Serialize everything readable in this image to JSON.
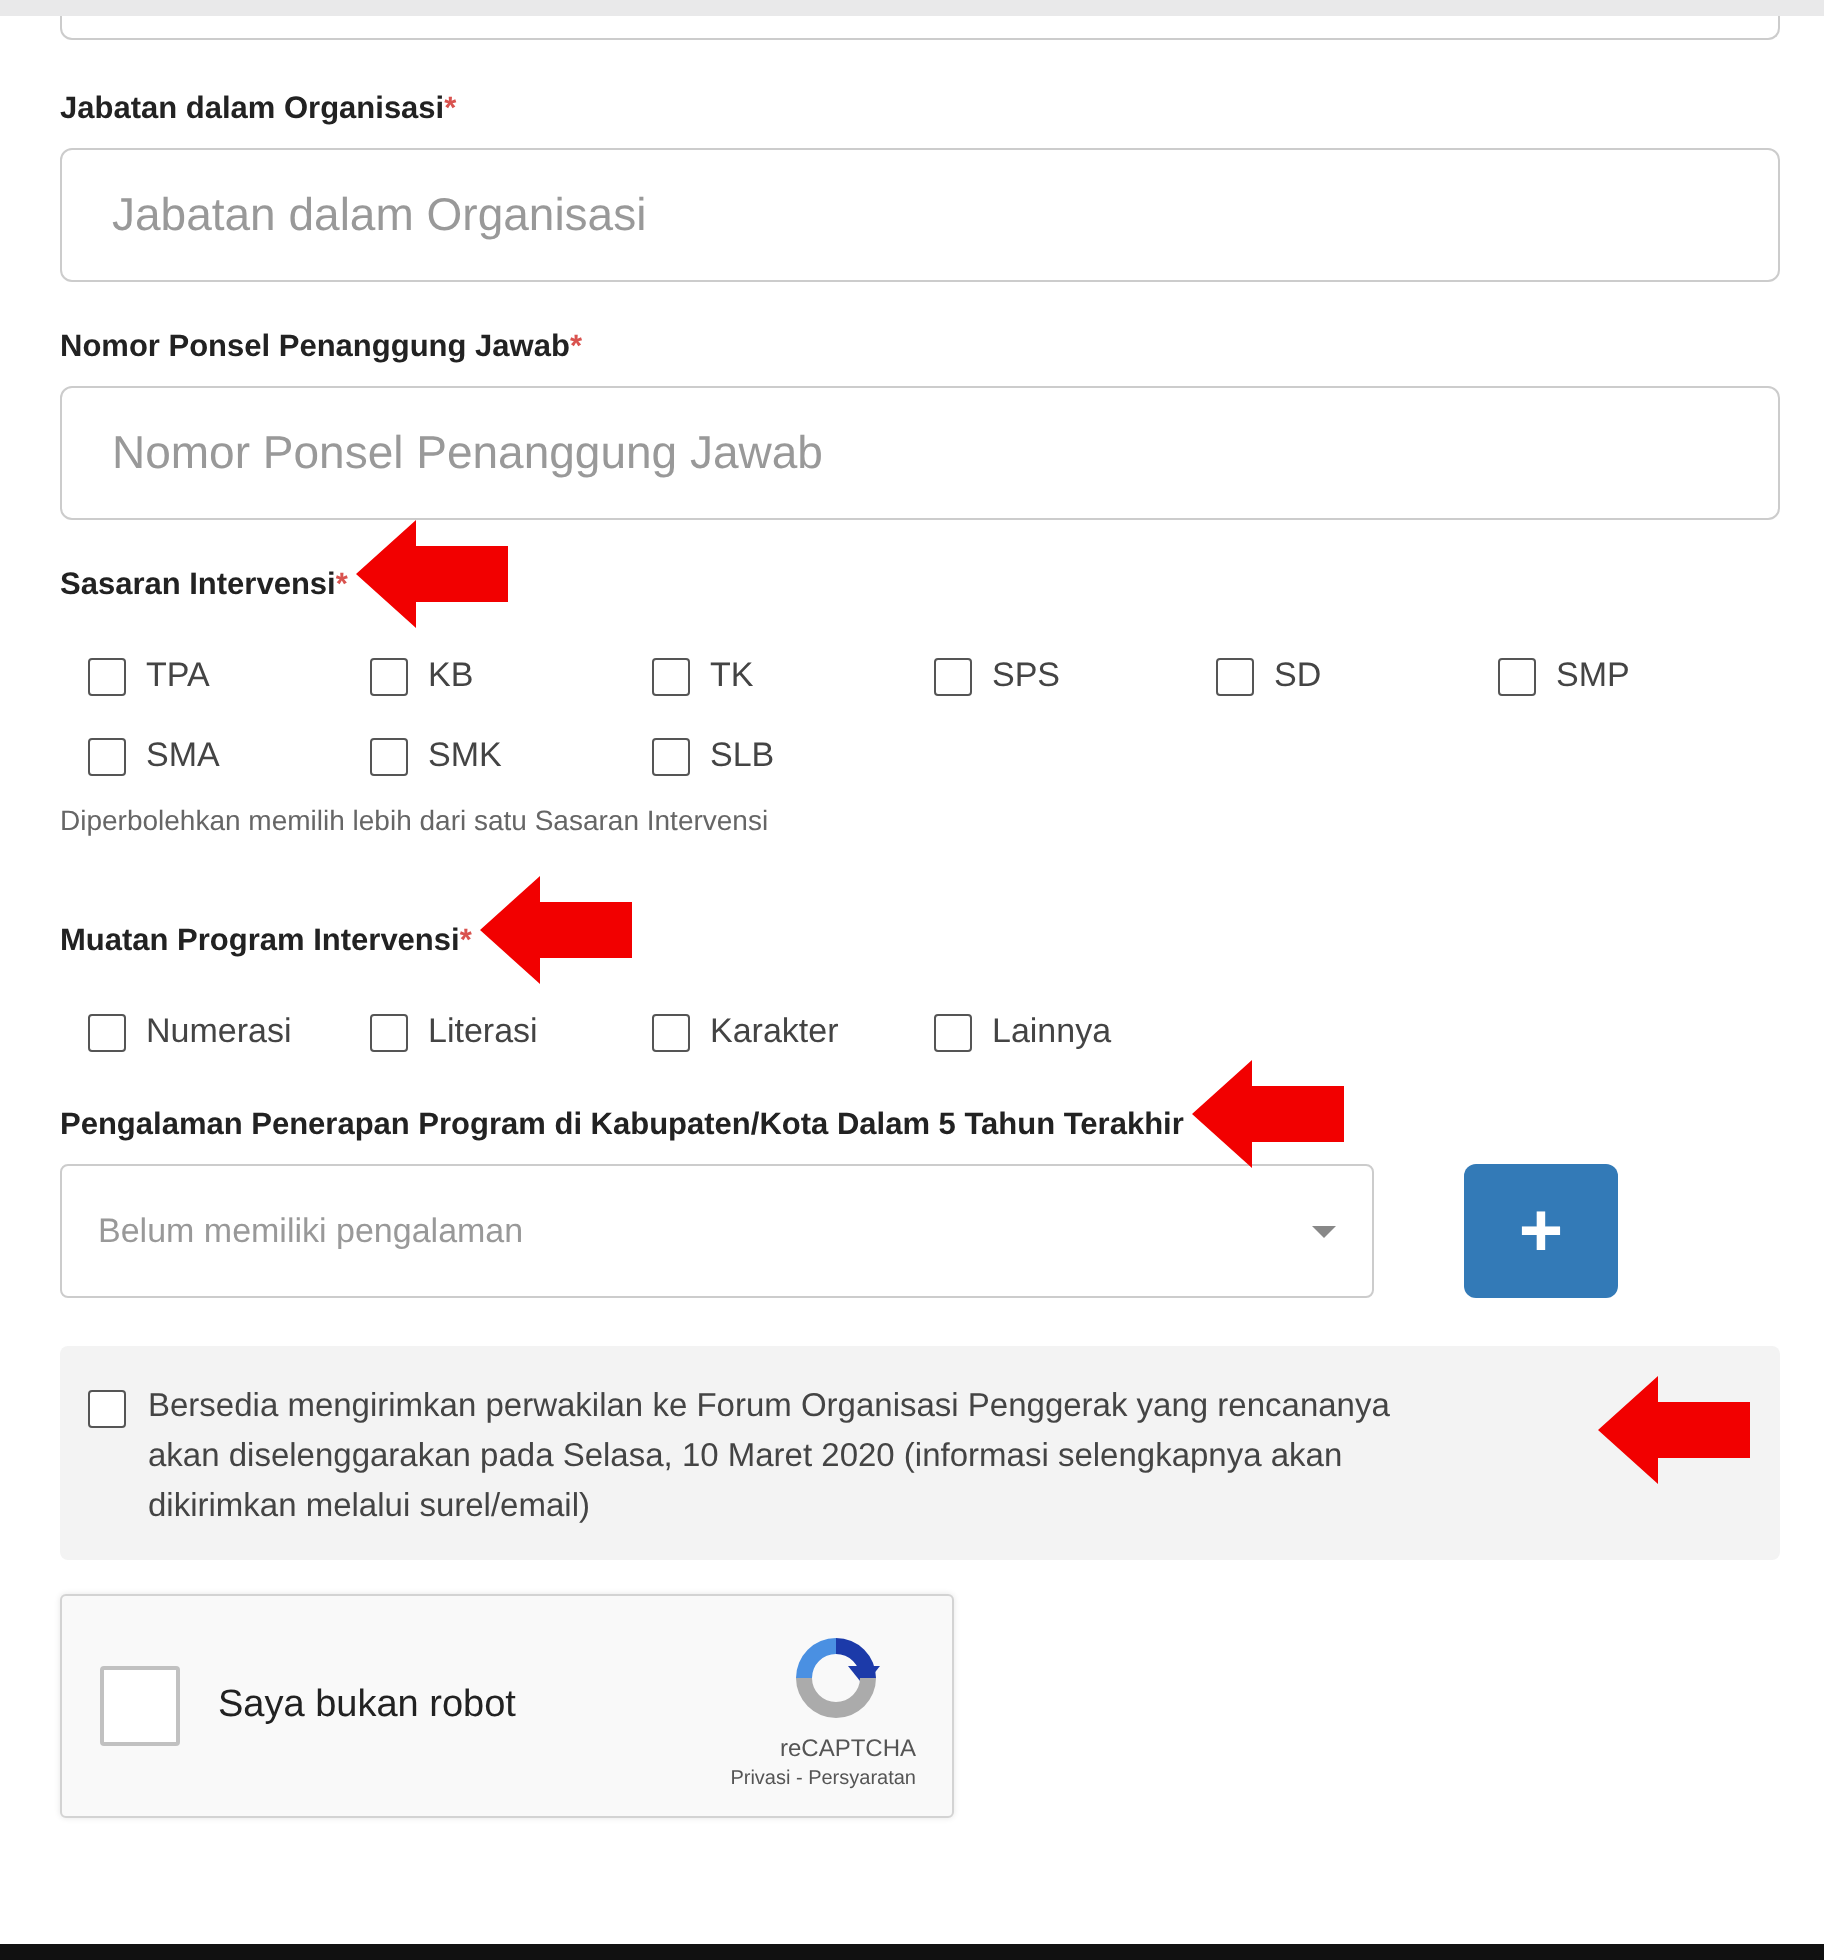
{
  "fields": [
    {
      "label": "Jabatan dalam Organisasi",
      "required_mark": "*",
      "placeholder": "Jabatan dalam Organisasi"
    },
    {
      "label": "Nomor Ponsel Penanggung Jawab",
      "required_mark": "*",
      "placeholder": "Nomor Ponsel Penanggung Jawab"
    }
  ],
  "sasaran": {
    "label": "Sasaran Intervensi",
    "required_mark": "*",
    "annotated": true,
    "options": [
      {
        "label": "TPA",
        "checked": false
      },
      {
        "label": "KB",
        "checked": false
      },
      {
        "label": "TK",
        "checked": false
      },
      {
        "label": "SPS",
        "checked": false
      },
      {
        "label": "SD",
        "checked": false
      },
      {
        "label": "SMP",
        "checked": false
      },
      {
        "label": "SMA",
        "checked": false
      },
      {
        "label": "SMK",
        "checked": false
      },
      {
        "label": "SLB",
        "checked": false
      }
    ],
    "help": "Diperbolehkan memilih lebih dari satu Sasaran Intervensi"
  },
  "muatan": {
    "label": "Muatan Program Intervensi",
    "required_mark": "*",
    "annotated": true,
    "options": [
      {
        "label": "Numerasi",
        "checked": false
      },
      {
        "label": "Literasi",
        "checked": false
      },
      {
        "label": "Karakter",
        "checked": false
      },
      {
        "label": "Lainnya",
        "checked": false
      }
    ]
  },
  "pengalaman": {
    "label": "Pengalaman Penerapan Program di Kabupaten/Kota Dalam 5 Tahun Terakhir",
    "annotated": true,
    "select_placeholder": "Belum memiliki pengalaman",
    "add_button": "+"
  },
  "forum_consent": {
    "text": "Bersedia mengirimkan perwakilan ke Forum Organisasi Penggerak yang rencananya akan diselenggarakan pada Selasa, 10 Maret 2020 (informasi selengkapnya akan dikirimkan melalui surel/email)",
    "checked": false,
    "annotated": true
  },
  "recaptcha": {
    "label": "Saya bukan robot",
    "checked": false,
    "brand": "reCAPTCHA",
    "links": "Privasi - Persyaratan"
  }
}
